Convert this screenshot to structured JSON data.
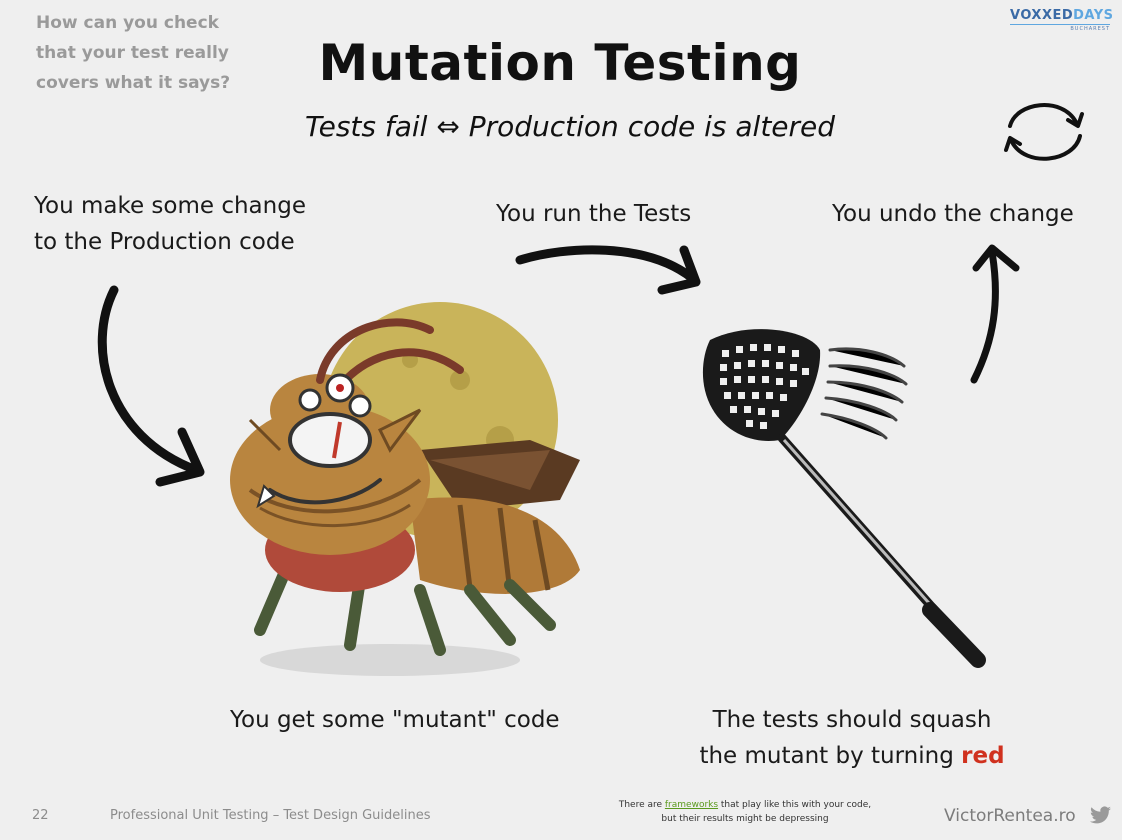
{
  "slide": {
    "question_lines": [
      "How can you check",
      "that your test really",
      "covers what it says?"
    ],
    "title": "Mutation Testing",
    "subtitle": "Tests fail ⇔ Production code is altered",
    "logo": {
      "main_a": "VOXXED",
      "main_b": "DAYS",
      "sub": "BUCHAREST"
    },
    "captions": {
      "make_change": [
        "You make some change",
        "to the Production code"
      ],
      "run_tests": "You run the Tests",
      "undo_change": "You undo the change",
      "mutant": "You get some \"mutant\" code",
      "squash_line1": "The tests should squash",
      "squash_line2_prefix": "the mutant by turning ",
      "squash_red_word": "red"
    },
    "footer": {
      "page_number": "22",
      "course": "Professional Unit Testing – Test Design Guidelines",
      "note_prefix": "There are ",
      "note_link": "frameworks",
      "note_suffix": " that play like this with your code,",
      "note_line2": "but their results might be depressing",
      "site": "VictorRentea.ro"
    },
    "icons": {
      "cycle": "refresh-cycle-icon",
      "bird": "twitter-bird-icon"
    },
    "colors": {
      "red_accent": "#d0311e",
      "link_green": "#5b9a1e",
      "logo_blue": "#3a6aa6"
    }
  }
}
